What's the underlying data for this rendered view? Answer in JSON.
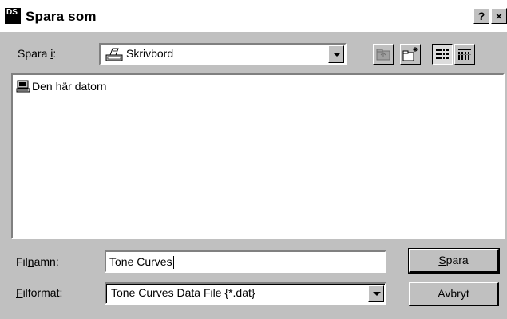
{
  "window": {
    "title": "Spara som",
    "app_icon_text": "DS",
    "help_label": "?",
    "close_label": "×"
  },
  "location": {
    "label_prefix": "Spara ",
    "label_accel": "i",
    "label_suffix": ":",
    "value": "Skrivbord"
  },
  "file_list": {
    "items": [
      {
        "label": "Den här datorn",
        "icon": "computer-icon"
      }
    ]
  },
  "filename": {
    "label_prefix": "Fil",
    "label_accel": "n",
    "label_suffix": "amn:",
    "value": "Tone Curves"
  },
  "fileformat": {
    "label_accel": "F",
    "label_suffix": "ilformat:",
    "value": "Tone Curves Data File {*.dat}"
  },
  "buttons": {
    "save_accel": "S",
    "save_suffix": "para",
    "cancel": "Avbryt"
  }
}
